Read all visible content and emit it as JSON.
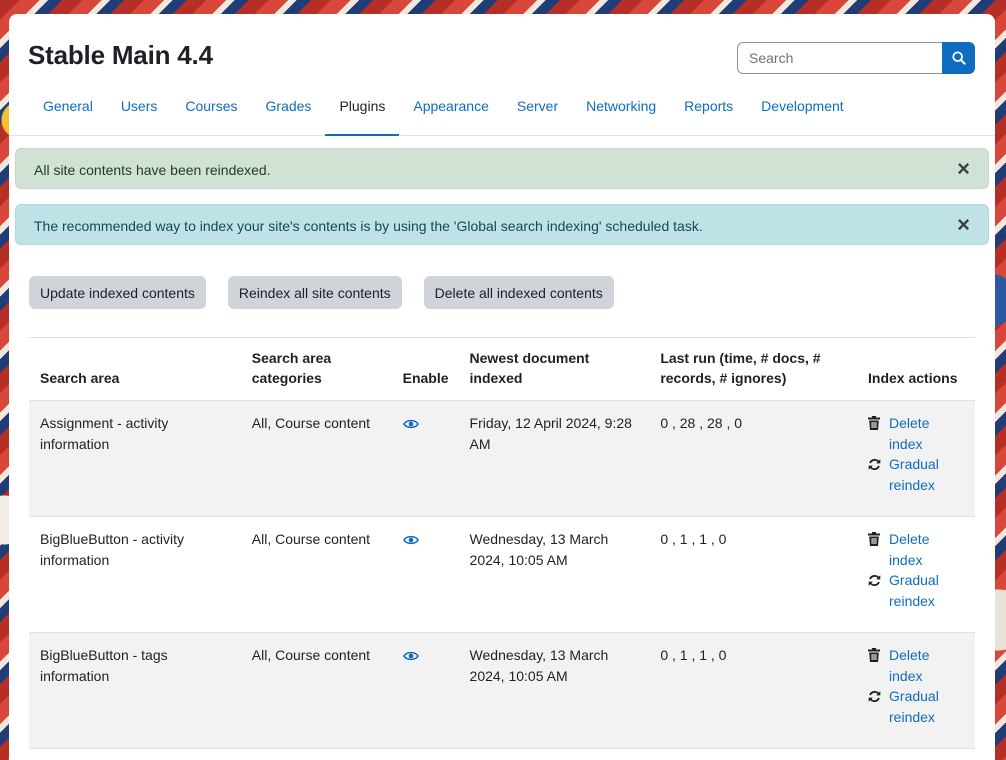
{
  "page": {
    "title": "Stable Main 4.4"
  },
  "search": {
    "placeholder": "Search"
  },
  "tabs": [
    {
      "label": "General"
    },
    {
      "label": "Users"
    },
    {
      "label": "Courses"
    },
    {
      "label": "Grades"
    },
    {
      "label": "Plugins",
      "active": true
    },
    {
      "label": "Appearance"
    },
    {
      "label": "Server"
    },
    {
      "label": "Networking"
    },
    {
      "label": "Reports"
    },
    {
      "label": "Development"
    }
  ],
  "alerts": {
    "success": "All site contents have been reindexed.",
    "info": "The recommended way to index your site's contents is by using the 'Global search indexing' scheduled task.",
    "close_symbol": "×"
  },
  "buttons": {
    "update": "Update indexed contents",
    "reindex": "Reindex all site contents",
    "delete_all": "Delete all indexed contents"
  },
  "table": {
    "headers": {
      "area": "Search area",
      "categories": "Search area categories",
      "enable": "Enable",
      "newest": "Newest document indexed",
      "lastrun": "Last run (time, # docs, # records, # ignores)",
      "actions": "Index actions"
    },
    "rows": [
      {
        "area": "Assignment - activity information",
        "categories": "All, Course content",
        "newest": "Friday, 12 April 2024, 9:28 AM",
        "lastrun": "0 , 28 , 28 , 0",
        "delete": "Delete index",
        "reindex": "Gradual reindex"
      },
      {
        "area": "BigBlueButton - activity information",
        "categories": "All, Course content",
        "newest": "Wednesday, 13 March 2024, 10:05 AM",
        "lastrun": "0 , 1 , 1 , 0",
        "delete": "Delete index",
        "reindex": "Gradual reindex"
      },
      {
        "area": "BigBlueButton - tags information",
        "categories": "All, Course content",
        "newest": "Wednesday, 13 March 2024, 10:05 AM",
        "lastrun": "0 , 1 , 1 , 0",
        "delete": "Delete index",
        "reindex": "Gradual reindex"
      }
    ]
  },
  "colors": {
    "accent": "#0f6cbf",
    "success_bg": "#d1e2d4",
    "info_bg": "#bfe2e6",
    "button_bg": "#ced4da"
  }
}
